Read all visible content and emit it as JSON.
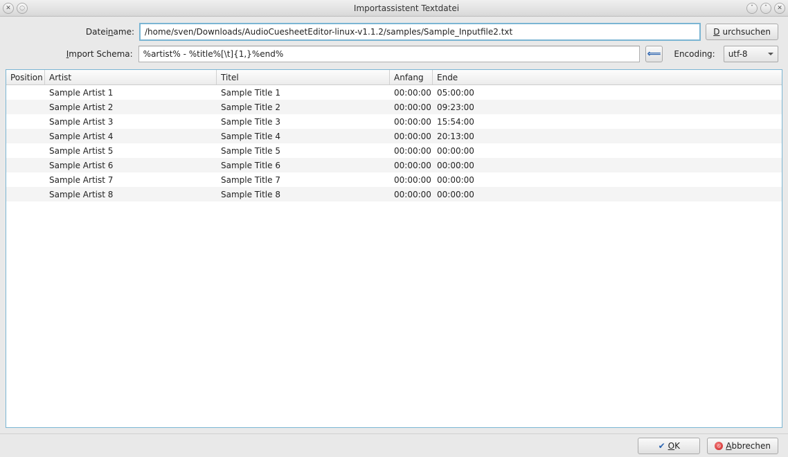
{
  "window": {
    "title": "Importassistent Textdatei"
  },
  "form": {
    "filename_label_pre": "Datei",
    "filename_label_mn": "n",
    "filename_label_post": "ame:",
    "filename_value": "/home/sven/Downloads/AudioCuesheetEditor-linux-v1.1.2/samples/Sample_Inputfile2.txt",
    "browse_label_mn": "D",
    "browse_label_post": "urchsuchen",
    "schema_label_mn": "I",
    "schema_label_post": "mport Schema:",
    "schema_value": "%artist% - %title%[\\t]{1,}%end%",
    "encoding_label": "Encoding:",
    "encoding_value": "utf-8"
  },
  "table": {
    "headers": {
      "position": "Position",
      "artist": "Artist",
      "title": "Titel",
      "anfang": "Anfang",
      "ende": "Ende"
    },
    "rows": [
      {
        "position": "",
        "artist": "Sample Artist 1",
        "title": "Sample Title 1",
        "anfang": "00:00:00",
        "ende": "05:00:00"
      },
      {
        "position": "",
        "artist": "Sample Artist 2",
        "title": "Sample Title 2",
        "anfang": "00:00:00",
        "ende": "09:23:00"
      },
      {
        "position": "",
        "artist": "Sample Artist 3",
        "title": "Sample Title 3",
        "anfang": "00:00:00",
        "ende": "15:54:00"
      },
      {
        "position": "",
        "artist": "Sample Artist 4",
        "title": "Sample Title 4",
        "anfang": "00:00:00",
        "ende": "20:13:00"
      },
      {
        "position": "",
        "artist": "Sample Artist 5",
        "title": "Sample Title 5",
        "anfang": "00:00:00",
        "ende": "00:00:00"
      },
      {
        "position": "",
        "artist": "Sample Artist 6",
        "title": "Sample Title 6",
        "anfang": "00:00:00",
        "ende": "00:00:00"
      },
      {
        "position": "",
        "artist": "Sample Artist 7",
        "title": "Sample Title 7",
        "anfang": "00:00:00",
        "ende": "00:00:00"
      },
      {
        "position": "",
        "artist": "Sample Artist 8",
        "title": "Sample Title 8",
        "anfang": "00:00:00",
        "ende": "00:00:00"
      }
    ]
  },
  "footer": {
    "ok_mn": "O",
    "ok_post": "K",
    "cancel_mn": "A",
    "cancel_post": "bbrechen"
  }
}
